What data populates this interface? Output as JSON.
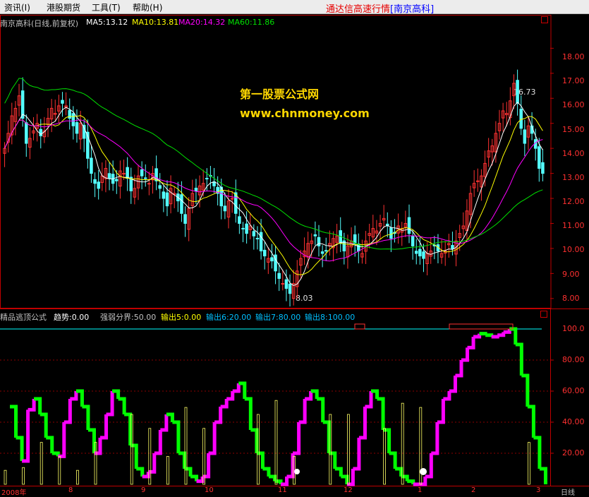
{
  "menu": {
    "items": [
      "资讯(I)",
      "港股期货",
      "工具(T)",
      "帮助(H)"
    ],
    "brand_name": "通达信高速行情",
    "brand_stock": "[南京高科]"
  },
  "main_chart": {
    "title": "南京高科(日线,前复权)",
    "ma5": "MA5:13.12",
    "ma10": "MA10:13.81",
    "ma20": "MA20:14.32",
    "ma60": "MA60:11.86",
    "high_label": "16.73",
    "low_label": "8.03",
    "watermark_line1": "第一股票公式网",
    "watermark_line2": "www.chnmoney.com",
    "y_ticks": [
      "18.00",
      "17.00",
      "16.00",
      "15.00",
      "14.00",
      "13.00",
      "12.00",
      "11.00",
      "10.00",
      "9.00",
      "8.00"
    ]
  },
  "indicator": {
    "name": "精品逃顶公式",
    "trend": "趋势:0.00",
    "strength": "强弱分界:50.00",
    "out5": "输出5:0.00",
    "out6": "输出6:20.00",
    "out7": "输出7:80.00",
    "out8": "输出8:100.00",
    "y_ticks": [
      "100.0",
      "80.00",
      "60.00",
      "40.00",
      "20.00"
    ]
  },
  "x_axis": {
    "labels": [
      "2008年",
      "8",
      "9",
      "10",
      "11",
      "12",
      "1",
      "2",
      "3"
    ],
    "period_label": "日线"
  },
  "colors": {
    "up": "#ff3232",
    "down": "#54ffff",
    "ma5": "#ffffff",
    "ma10": "#ffff00",
    "ma20": "#ff00ff",
    "ma60": "#00e000",
    "axis": "#c00000",
    "grid": "#8b0000",
    "line100": "#00ffff",
    "osc_up": "#ff00ff",
    "osc_down": "#00ff00",
    "osc_bars": "#ffff66"
  },
  "chart_data": {
    "type": "line",
    "series": [
      {
        "name": "MA5",
        "last": 13.12
      },
      {
        "name": "MA10",
        "last": 13.81
      },
      {
        "name": "MA20",
        "last": 14.32
      },
      {
        "name": "MA60",
        "last": 11.86
      }
    ],
    "price_high": 16.73,
    "price_low": 8.03,
    "ylim": [
      7.6,
      18.8
    ],
    "indicator_ylim": [
      0,
      105
    ],
    "closes": [
      14.0,
      14.6,
      15.3,
      15.6,
      16.1,
      15.2,
      14.2,
      14.4,
      14.7,
      15.0,
      14.5,
      14.7,
      15.2,
      15.6,
      15.4,
      15.7,
      15.8,
      15.7,
      15.2,
      14.9,
      14.6,
      15.0,
      14.4,
      13.6,
      13.0,
      12.6,
      12.4,
      12.9,
      13.2,
      12.8,
      12.6,
      12.7,
      13.1,
      13.0,
      12.8,
      12.3,
      12.4,
      12.9,
      12.9,
      12.8,
      12.6,
      13.0,
      12.7,
      12.4,
      12.0,
      11.7,
      12.4,
      12.2,
      11.9,
      11.4,
      11.0,
      11.6,
      12.2,
      12.3,
      12.5,
      12.6,
      12.8,
      12.9,
      12.5,
      12.2,
      11.7,
      11.5,
      11.9,
      12.0,
      11.4,
      11.0,
      10.8,
      10.6,
      10.9,
      10.5,
      10.4,
      9.9,
      9.7,
      9.6,
      9.5,
      9.1,
      8.8,
      8.6,
      8.4,
      8.2,
      8.6,
      9.1,
      9.6,
      9.9,
      10.2,
      10.3,
      10.5,
      10.1,
      9.8,
      9.9,
      10.2,
      10.4,
      10.5,
      10.2,
      9.9,
      10.1,
      10.3,
      10.2,
      9.9,
      9.8,
      10.3,
      10.6,
      10.8,
      10.7,
      11.0,
      11.2,
      10.9,
      10.4,
      10.6,
      10.9,
      10.8,
      11.0,
      10.6,
      10.1,
      9.8,
      9.7,
      9.6,
      9.8,
      9.9,
      10.1,
      9.9,
      9.8,
      9.9,
      10.2,
      10.0,
      10.3,
      10.6,
      10.9,
      11.5,
      12.2,
      12.6,
      12.7,
      12.9,
      13.4,
      13.9,
      14.1,
      14.6,
      15.0,
      15.5,
      15.4,
      15.9,
      16.6,
      15.8,
      14.8,
      14.2,
      14.9,
      14.6,
      14.0,
      13.2,
      13.0
    ],
    "indicator": [
      50,
      30,
      15,
      48,
      55,
      45,
      30,
      20,
      18,
      40,
      55,
      60,
      50,
      35,
      20,
      30,
      45,
      60,
      55,
      45,
      25,
      10,
      5,
      8,
      20,
      35,
      45,
      40,
      20,
      10,
      5,
      2,
      5,
      20,
      40,
      50,
      55,
      60,
      65,
      55,
      35,
      20,
      10,
      5,
      2,
      0,
      5,
      20,
      40,
      55,
      60,
      55,
      40,
      20,
      10,
      5,
      0,
      10,
      30,
      50,
      60,
      55,
      35,
      20,
      10,
      5,
      2,
      0,
      0,
      5,
      20,
      40,
      55,
      60,
      70,
      80,
      88,
      95,
      97,
      96,
      95,
      96,
      98,
      100,
      90,
      70,
      50,
      30,
      10,
      0
    ]
  }
}
